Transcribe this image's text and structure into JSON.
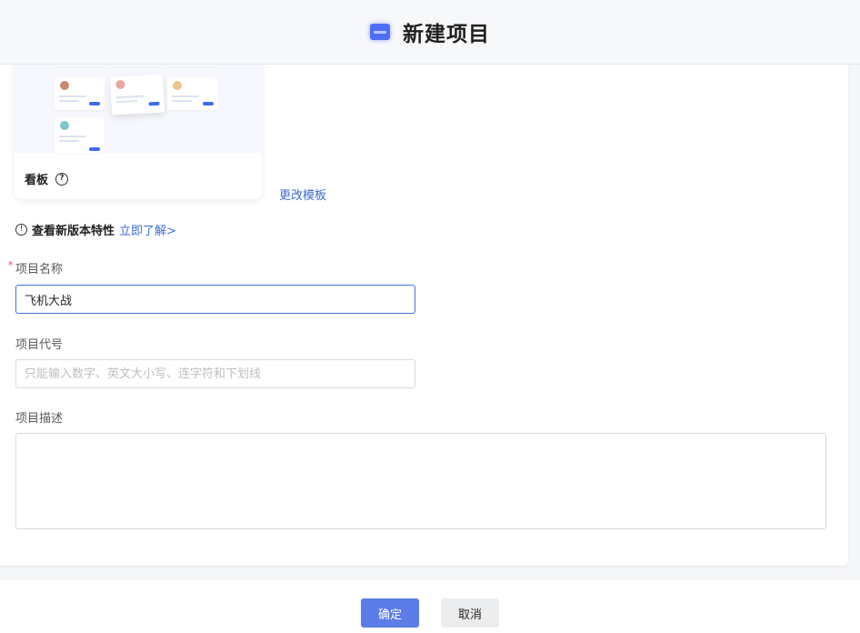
{
  "header": {
    "title": "新建项目",
    "icon": "project-icon"
  },
  "template": {
    "name": "看板",
    "help_icon": "?",
    "change_label": "更改模板"
  },
  "info": {
    "icon": "!",
    "text": "查看新版本特性",
    "link": "立即了解>"
  },
  "form": {
    "required_mark": "*",
    "name_label": "项目名称",
    "name_value": "飞机大战",
    "code_label": "项目代号",
    "code_placeholder": "只能输入数字、英文大小写、连字符和下划线",
    "desc_label": "项目描述",
    "desc_value": ""
  },
  "footer": {
    "confirm": "确定",
    "cancel": "取消"
  },
  "colors": {
    "accent": "#5c7ce8",
    "link": "#3d6bd6",
    "required": "#e34d59"
  }
}
